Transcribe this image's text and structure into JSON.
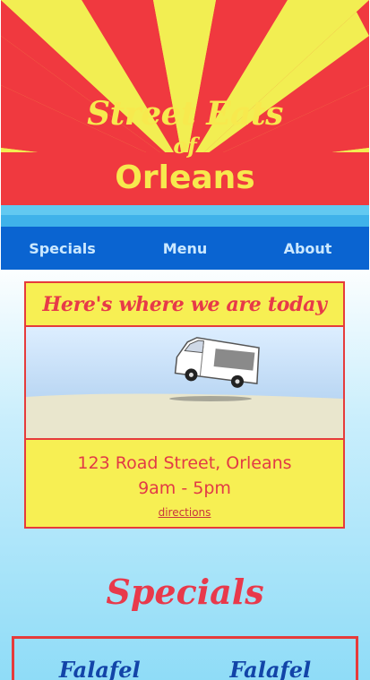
{
  "header": {
    "title_line1": "Street Eats",
    "title_line2": "of",
    "title_line3": "Orleans"
  },
  "nav": {
    "items": [
      {
        "label": "Specials"
      },
      {
        "label": "Menu"
      },
      {
        "label": "About"
      }
    ]
  },
  "location": {
    "heading": "Here's where we are today",
    "address": "123 Road Street, Orleans",
    "hours": "9am - 5pm",
    "directions_label": "directions"
  },
  "specials": {
    "heading": "Specials",
    "items": [
      {
        "name": "Falafel"
      },
      {
        "name": "Falafel"
      }
    ]
  },
  "colors": {
    "red": "#f0393f",
    "yellow": "#f7e94e",
    "nav_blue": "#0a64d1",
    "light_blue": "#62c9f1"
  },
  "icons": {
    "truck": "food-truck-icon"
  }
}
